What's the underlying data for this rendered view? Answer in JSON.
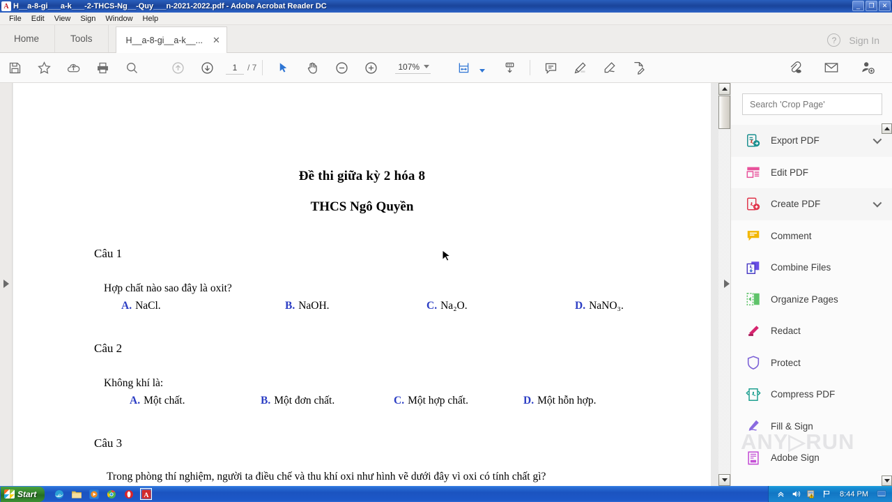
{
  "window": {
    "title": "H__a-8-gi___a-k___-2-THCS-Ng__-Quy___n-2021-2022.pdf - Adobe Acrobat Reader DC",
    "app_icon": "adobe-acrobat-icon",
    "minimize_label": "_",
    "restore_label": "❐",
    "close_label": "✕"
  },
  "menubar": {
    "items": [
      "File",
      "Edit",
      "View",
      "Sign",
      "Window",
      "Help"
    ]
  },
  "tabbar": {
    "home_label": "Home",
    "tools_label": "Tools",
    "document_tab_label": "H__a-8-gi__a-k__...",
    "document_tab_close": "✕",
    "help_label": "?",
    "signin_label": "Sign In"
  },
  "toolbar": {
    "icons_left": [
      "save-icon",
      "add-to-favorites-icon",
      "upload-cloud-icon",
      "print-icon",
      "find-icon"
    ],
    "page_up_icon": "page-up-icon",
    "page_down_icon": "page-down-icon",
    "page_number": "1",
    "page_total": "/ 7",
    "select_tool_icon": "select-cursor-icon",
    "hand_tool_icon": "hand-tool-icon",
    "zoom_out_icon": "zoom-out-icon",
    "zoom_in_icon": "zoom-in-icon",
    "zoom_value": "107%",
    "fit_page_icon": "fit-page-icon",
    "scroll_mode_icon": "scroll-mode-icon",
    "comment_icon": "comment-icon",
    "highlight_icon": "highlight-icon",
    "draw_icon": "draw-freehand-icon",
    "fill_sign_icon": "fill-sign-icon",
    "attach_icon": "attach-cloud-icon",
    "email_icon": "email-icon",
    "share_user_icon": "share-with-user-icon"
  },
  "right_panel": {
    "search_placeholder": "Search 'Crop Page'",
    "tools": [
      {
        "label": "Export PDF",
        "icon": "export-pdf-icon",
        "has_chevron": true
      },
      {
        "label": "Edit PDF",
        "icon": "edit-pdf-icon",
        "has_chevron": false
      },
      {
        "label": "Create PDF",
        "icon": "create-pdf-icon",
        "has_chevron": true
      },
      {
        "label": "Comment",
        "icon": "comment-icon",
        "has_chevron": false
      },
      {
        "label": "Combine Files",
        "icon": "combine-files-icon",
        "has_chevron": false
      },
      {
        "label": "Organize Pages",
        "icon": "organize-pages-icon",
        "has_chevron": false
      },
      {
        "label": "Redact",
        "icon": "redact-icon",
        "has_chevron": false
      },
      {
        "label": "Protect",
        "icon": "protect-shield-icon",
        "has_chevron": false
      },
      {
        "label": "Compress PDF",
        "icon": "compress-pdf-icon",
        "has_chevron": false
      },
      {
        "label": "Fill & Sign",
        "icon": "fill-sign-icon",
        "has_chevron": false
      },
      {
        "label": "Adobe Sign",
        "icon": "adobe-sign-icon",
        "has_chevron": false
      }
    ]
  },
  "document": {
    "title": "Đề thi giữa kỳ 2 hóa 8",
    "subtitle": "THCS Ngô Quyền",
    "questions": [
      {
        "label": "Câu 1",
        "stem": "Hợp chất nào sao đây là oxit?",
        "options": [
          {
            "key": "A.",
            "text": "NaCl."
          },
          {
            "key": "B.",
            "text": "NaOH."
          },
          {
            "key": "C.",
            "text": "Na₂O."
          },
          {
            "key": "D.",
            "text": "NaNO₃."
          }
        ]
      },
      {
        "label": "Câu 2",
        "stem": "Không khí là:",
        "options": [
          {
            "key": "A.",
            "text": "Một chất."
          },
          {
            "key": "B.",
            "text": "Một đơn chất."
          },
          {
            "key": "C.",
            "text": "Một hợp chất."
          },
          {
            "key": "D.",
            "text": "Một hỗn hợp."
          }
        ]
      },
      {
        "label": "Câu 3",
        "stem": "Trong phòng thí nghiệm, người ta điều chế và thu khí oxi như hình vẽ dưới đây vì oxi có tính chất gì?",
        "options": []
      }
    ]
  },
  "watermark": {
    "text": "ANY▷RUN"
  },
  "taskbar": {
    "start_label": "Start",
    "quick_launch": [
      "internet-explorer-icon",
      "folder-icon",
      "media-player-icon",
      "chrome-icon",
      "opera-icon",
      "adobe-reader-icon"
    ],
    "tray_icons": [
      "chevron-up-icon",
      "volume-icon",
      "security-alert-icon",
      "flag-icon"
    ],
    "clock": "8:44 PM",
    "show-desktop": "show-desktop-icon"
  },
  "colors": {
    "titlebar_blue": "#1b459b",
    "option_key_blue": "#2c3ec4",
    "panel_bg": "#fbfbfb",
    "doc_bg": "#ffffff"
  }
}
